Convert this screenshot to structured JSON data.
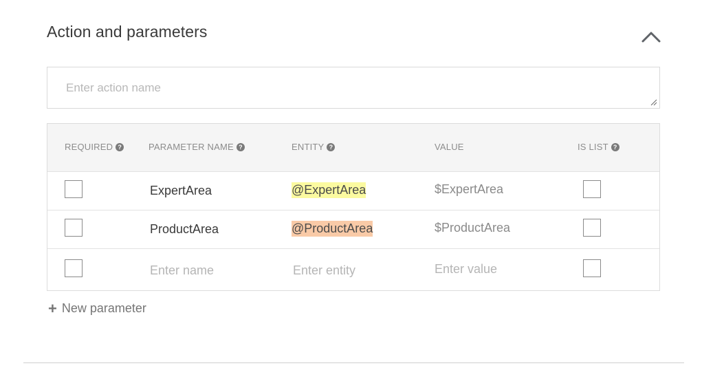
{
  "section": {
    "title": "Action and parameters"
  },
  "action_input": {
    "placeholder": "Enter action name",
    "value": ""
  },
  "table": {
    "headers": {
      "required": "REQUIRED",
      "parameter_name": "PARAMETER NAME",
      "entity": "ENTITY",
      "value": "VALUE",
      "is_list": "IS LIST"
    },
    "help_glyph": "?",
    "rows": [
      {
        "required": false,
        "name": "ExpertArea",
        "entity": "@ExpertArea",
        "entity_color": "#fbfaa0",
        "value": "$ExpertArea",
        "is_list": false
      },
      {
        "required": false,
        "name": "ProductArea",
        "entity": "@ProductArea",
        "entity_color": "#f9caa7",
        "value": "$ProductArea",
        "is_list": false
      }
    ],
    "new_row": {
      "name_placeholder": "Enter name",
      "entity_placeholder": "Enter entity",
      "value_placeholder": "Enter value"
    }
  },
  "new_parameter": {
    "icon": "plus-icon",
    "plus_glyph": "+",
    "label": "New parameter"
  },
  "icons": {
    "collapse": "chevron-up-icon",
    "help": "help-circle-icon"
  },
  "colors": {
    "entity_expert": "#fbfaa0",
    "entity_product": "#f9caa7"
  }
}
